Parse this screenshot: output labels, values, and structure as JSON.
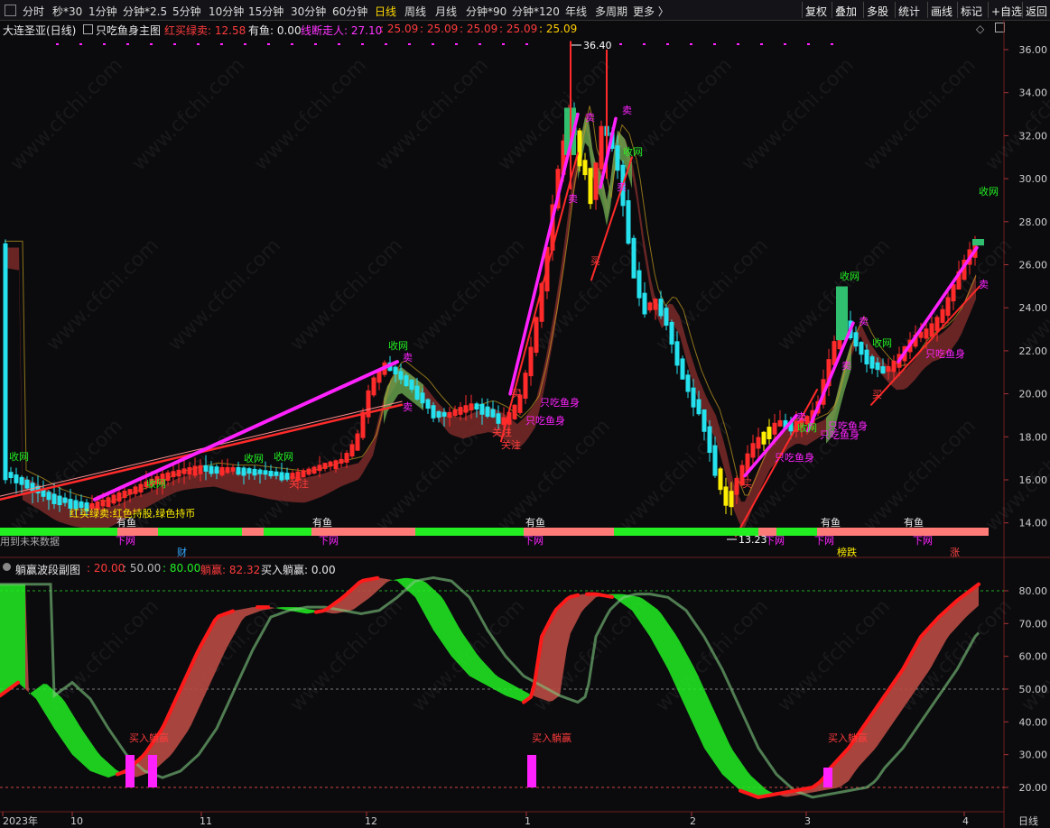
{
  "toolbar": {
    "left_items": [
      "分时",
      "秒*30",
      "1分钟",
      "分钟*2.5",
      "5分钟",
      "10分钟",
      "15分钟",
      "30分钟",
      "60分钟",
      "日线",
      "周线",
      "月线",
      "分钟*90",
      "分钟*120",
      "年线",
      "多周期",
      "更多 〉"
    ],
    "active": "日线",
    "right_items": [
      "复权",
      "叠加",
      "多股",
      "统计",
      "画线",
      "标记",
      "+自选",
      "返回"
    ]
  },
  "main_info": {
    "stock": "大连圣亚(日线)",
    "indicator": "只吃鱼身主图",
    "hong_mai_label": "红买绿卖: 12.58",
    "you_yu_label": "有鱼: 0.00",
    "xian_duan_label": "线断走人: 27.10",
    "values": [
      ": 25.09",
      ": 25.09",
      ": 25.09",
      ": 25.09",
      ": 25.09"
    ]
  },
  "sub_info": {
    "indicator": "躺赢波段副图",
    "v1": ": 20.00",
    "v2": ": 50.00",
    "v3": ": 80.00",
    "tangying": "躺赢: 82.32",
    "mairu": "买入躺赢: 0.00"
  },
  "colors": {
    "up": "#ff2a2a",
    "down": "#25e2ee",
    "magenta": "#ff22ff",
    "green": "#22ee22",
    "salmon": "#ff7b78",
    "yellow": "#ffee00",
    "brown": "#b84a42"
  },
  "price_axis": [
    "36.00",
    "34.00",
    "32.00",
    "30.00",
    "28.00",
    "26.00",
    "24.00",
    "22.00",
    "20.00",
    "18.00",
    "16.00",
    "14.00"
  ],
  "osc_axis": [
    "80.00",
    "70.00",
    "60.00",
    "50.00",
    "40.00",
    "30.00",
    "20.00"
  ],
  "time_axis": [
    "2023年",
    "10",
    "11",
    "12",
    "1",
    "2",
    "3",
    "4"
  ],
  "time_axis_right": "日线",
  "labels": {
    "shouwang": "收网",
    "mai4": "卖",
    "mai3": "买",
    "guanzhu": "关注",
    "zhichi": "只吃鱼身",
    "youyu": "有鱼",
    "xiawang": "下网",
    "buy_tangying": "买入躺赢",
    "legend_text": "红买绿卖:红色持股,绿色持币",
    "future_data": "用到未来数据",
    "cai": "财",
    "bangdie": "榜跌",
    "zhang": "涨",
    "high_mark": "36.40",
    "low_mark": "13.23"
  },
  "watermark": "www.cfchi.com"
}
